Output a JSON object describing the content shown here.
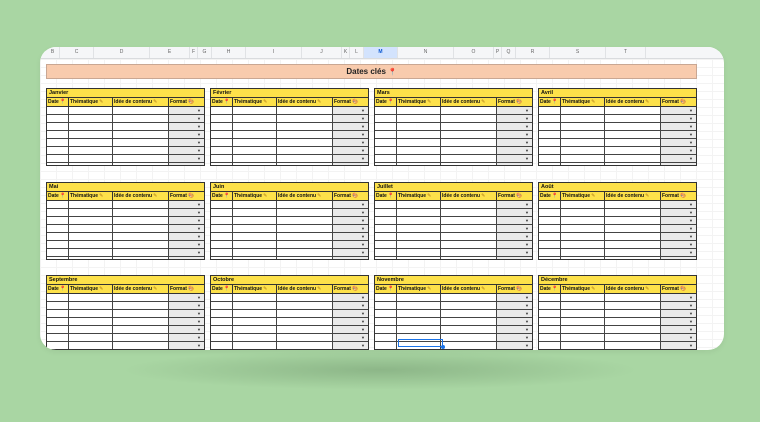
{
  "column_letters": [
    "B",
    "C",
    "D",
    "E",
    "F",
    "G",
    "H",
    "I",
    "J",
    "K",
    "L",
    "M",
    "N",
    "O",
    "P",
    "Q",
    "R",
    "S",
    "T"
  ],
  "selected_column": "M",
  "title": "Dates clés",
  "title_icon": "round-pushpin-icon",
  "headers": {
    "date": "Date",
    "theme": "Thématique",
    "idea": "Idée de contenu",
    "format": "Format"
  },
  "months": [
    "Janvier",
    "Février",
    "Mars",
    "Avril",
    "Mai",
    "Juin",
    "Juillet",
    "Août",
    "Septembre",
    "Octobre",
    "Novembre",
    "Décembre"
  ],
  "colors": {
    "title_bg": "#f8cbad",
    "header_bg": "#fde14a",
    "format_cell_bg": "#eaeaea",
    "selection": "#1a73e8",
    "background": "#a9d6a3"
  }
}
